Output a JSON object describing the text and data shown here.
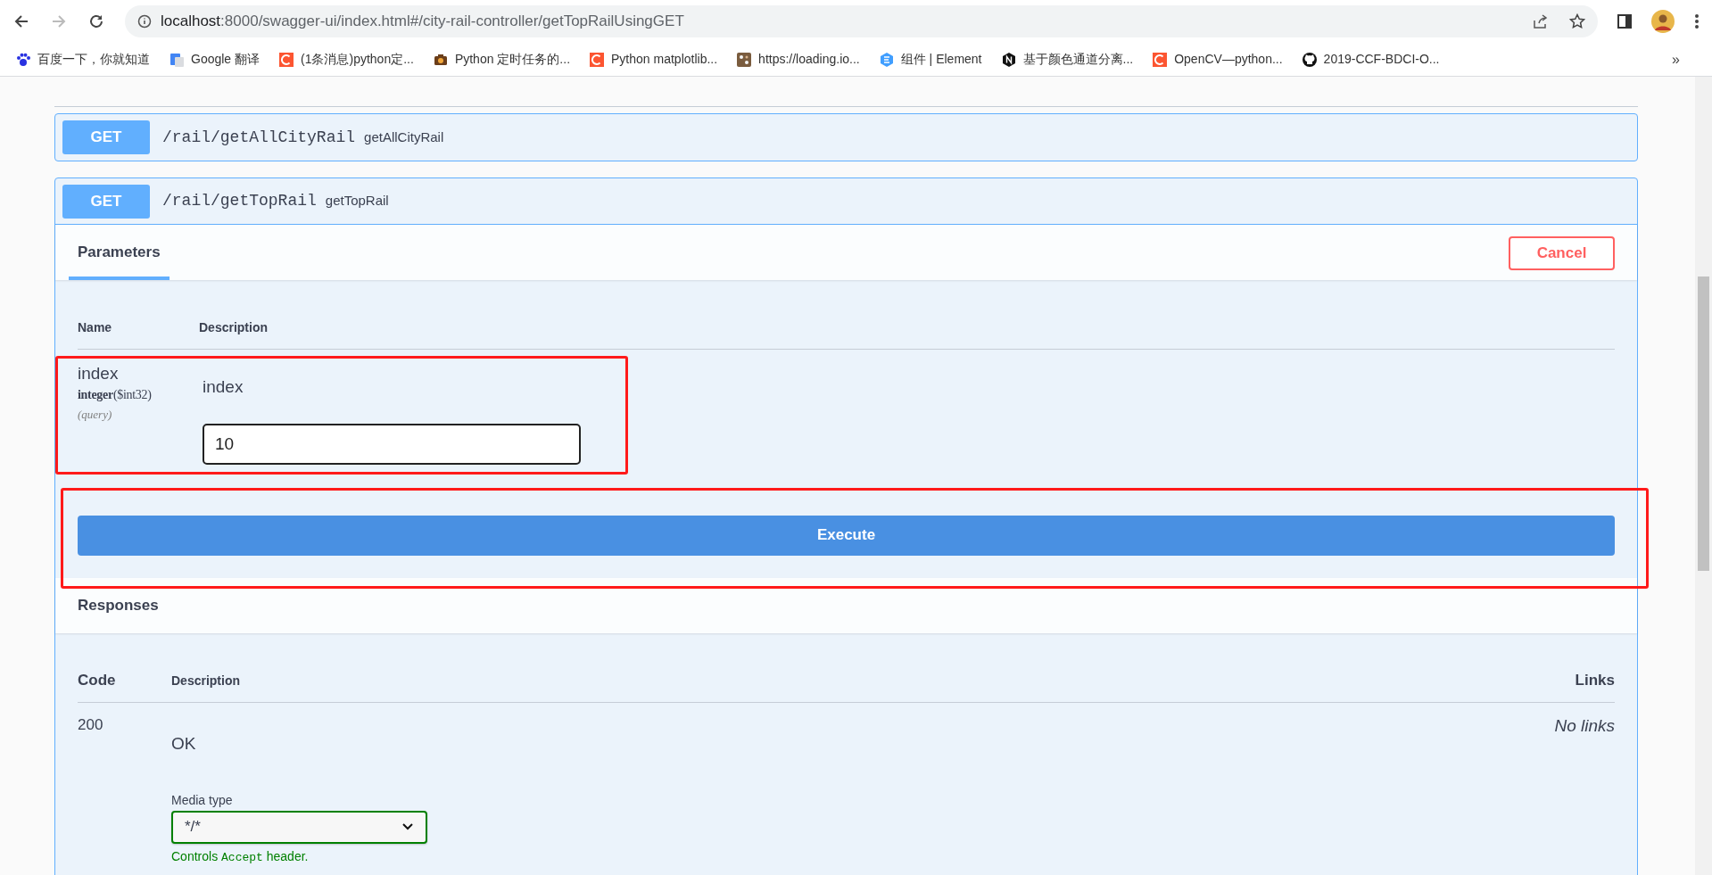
{
  "browser": {
    "forward_disabled": true,
    "url_host": "localhost",
    "url_rest": ":8000/swagger-ui/index.html#/city-rail-controller/getTopRailUsingGET",
    "bookmarks": [
      {
        "label": "百度一下，你就知道",
        "kind": "paw"
      },
      {
        "label": "Google 翻译",
        "kind": "translate"
      },
      {
        "label": "(1条消息)python定...",
        "kind": "csdn"
      },
      {
        "label": "Python 定时任务的...",
        "kind": "camera"
      },
      {
        "label": "Python matplotlib...",
        "kind": "csdn"
      },
      {
        "label": "https://loading.io...",
        "kind": "loading"
      },
      {
        "label": "组件 | Element",
        "kind": "element"
      },
      {
        "label": "基于颜色通道分离...",
        "kind": "hexagon"
      },
      {
        "label": "OpenCV—python...",
        "kind": "csdn"
      },
      {
        "label": "2019-CCF-BDCI-O...",
        "kind": "github"
      }
    ],
    "overflow": "»"
  },
  "operations": [
    {
      "method": "GET",
      "path": "/rail/getAllCityRail",
      "summary": "getAllCityRail",
      "expanded": false
    },
    {
      "method": "GET",
      "path": "/rail/getTopRail",
      "summary": "getTopRail",
      "expanded": true
    }
  ],
  "parameters": {
    "tab": "Parameters",
    "cancel": "Cancel",
    "columns": [
      "Name",
      "Description"
    ],
    "rows": [
      {
        "name": "index",
        "type": "integer",
        "format": "($int32)",
        "location": "(query)",
        "description": "index",
        "value": "10"
      }
    ],
    "execute": "Execute"
  },
  "responses": {
    "title": "Responses",
    "columns": [
      "Code",
      "Description",
      "Links"
    ],
    "rows": [
      {
        "code": "200",
        "description": "OK",
        "media_label": "Media type",
        "media_value": "*/*",
        "note": [
          "Controls ",
          "Accept",
          " header."
        ],
        "links": "No links"
      }
    ]
  },
  "highlights": [
    {
      "kind": "rectangle"
    },
    {
      "kind": "rectangle"
    }
  ]
}
